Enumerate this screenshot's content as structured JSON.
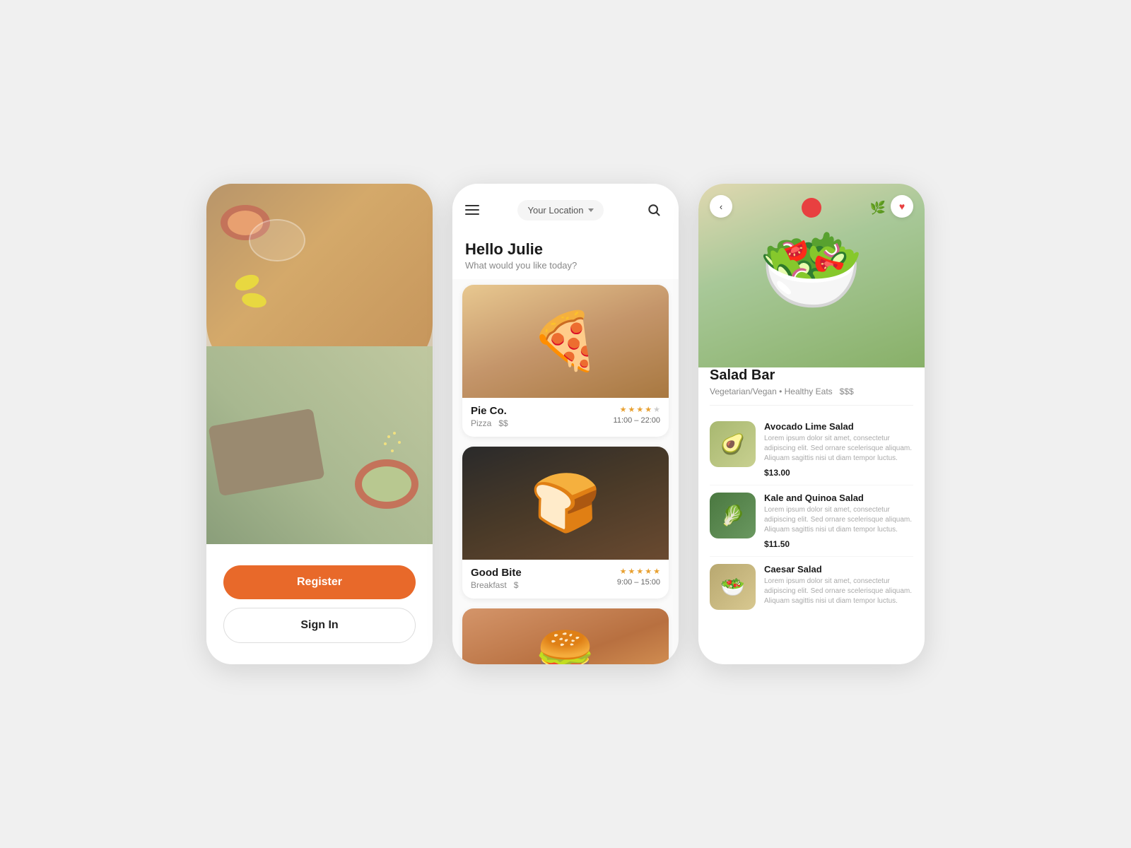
{
  "app": {
    "bg_color": "#f0f0f0",
    "accent_color": "#e8692a"
  },
  "screen1": {
    "register_label": "Register",
    "signin_label": "Sign In"
  },
  "screen2": {
    "location_placeholder": "Your Location",
    "greeting_name": "Hello Julie",
    "greeting_sub": "What would you like today?",
    "restaurants": [
      {
        "name": "Pie Co.",
        "category": "Pizza",
        "price": "$$",
        "hours": "11:00 – 22:00",
        "rating": 3.5,
        "stars_full": 3,
        "stars_half": 1,
        "stars_empty": 1
      },
      {
        "name": "Good Bite",
        "category": "Breakfast",
        "price": "$",
        "hours": "9:00 – 15:00",
        "rating": 5,
        "stars_full": 5,
        "stars_half": 0,
        "stars_empty": 0
      },
      {
        "name": "",
        "category": "",
        "price": "",
        "hours": "",
        "rating": 0
      }
    ]
  },
  "screen3": {
    "back_label": "‹",
    "restaurant_name": "Salad Bar",
    "tags": "Vegetarian/Vegan • Healthy Eats",
    "price_tier": "$$$",
    "menu_items": [
      {
        "name": "Avocado Lime Salad",
        "description": "Lorem ipsum dolor sit amet, consectetur adipiscing elit. Sed ornare scelerisque aliquam. Aliquam sagittis nisi ut diam tempor luctus.",
        "price": "$13.00",
        "emoji": "🥑"
      },
      {
        "name": "Kale and Quinoa Salad",
        "description": "Lorem ipsum dolor sit amet, consectetur adipiscing elit. Sed ornare scelerisque aliquam. Aliquam sagittis nisi ut diam tempor luctus.",
        "price": "$11.50",
        "emoji": "🥬"
      },
      {
        "name": "Caesar Salad",
        "description": "Lorem ipsum dolor sit amet, consectetur adipiscing elit. Sed ornare scelerisque aliquam. Aliquam sagittis nisi ut diam tempor luctus.",
        "price": "",
        "emoji": "🥗"
      }
    ]
  }
}
